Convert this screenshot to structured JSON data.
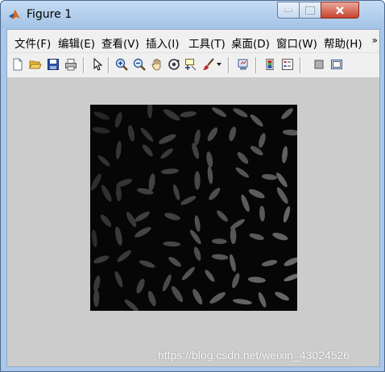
{
  "window": {
    "title": "Figure 1"
  },
  "menu": {
    "items": [
      "文件(F)",
      "编辑(E)",
      "查看(V)",
      "插入(I)",
      "工具(T)",
      "桌面(D)",
      "窗口(W)",
      "帮助(H)"
    ],
    "overflow": "»"
  },
  "toolbar": {
    "icons": [
      "new-figure-icon",
      "open-file-icon",
      "save-icon",
      "print-icon",
      "pointer-icon",
      "zoom-in-icon",
      "zoom-out-icon",
      "pan-hand-icon",
      "rotate-3d-icon",
      "data-cursor-icon",
      "brush-icon",
      "brush-dropdown-icon",
      "link-plot-icon",
      "colorbar-icon",
      "legend-icon",
      "hide-plot-tools-icon",
      "show-plot-tools-icon"
    ]
  },
  "figure": {
    "image": "grayscale rice grains on dark background"
  },
  "watermark": "https://blog.csdn.net/weixin_43024526"
}
